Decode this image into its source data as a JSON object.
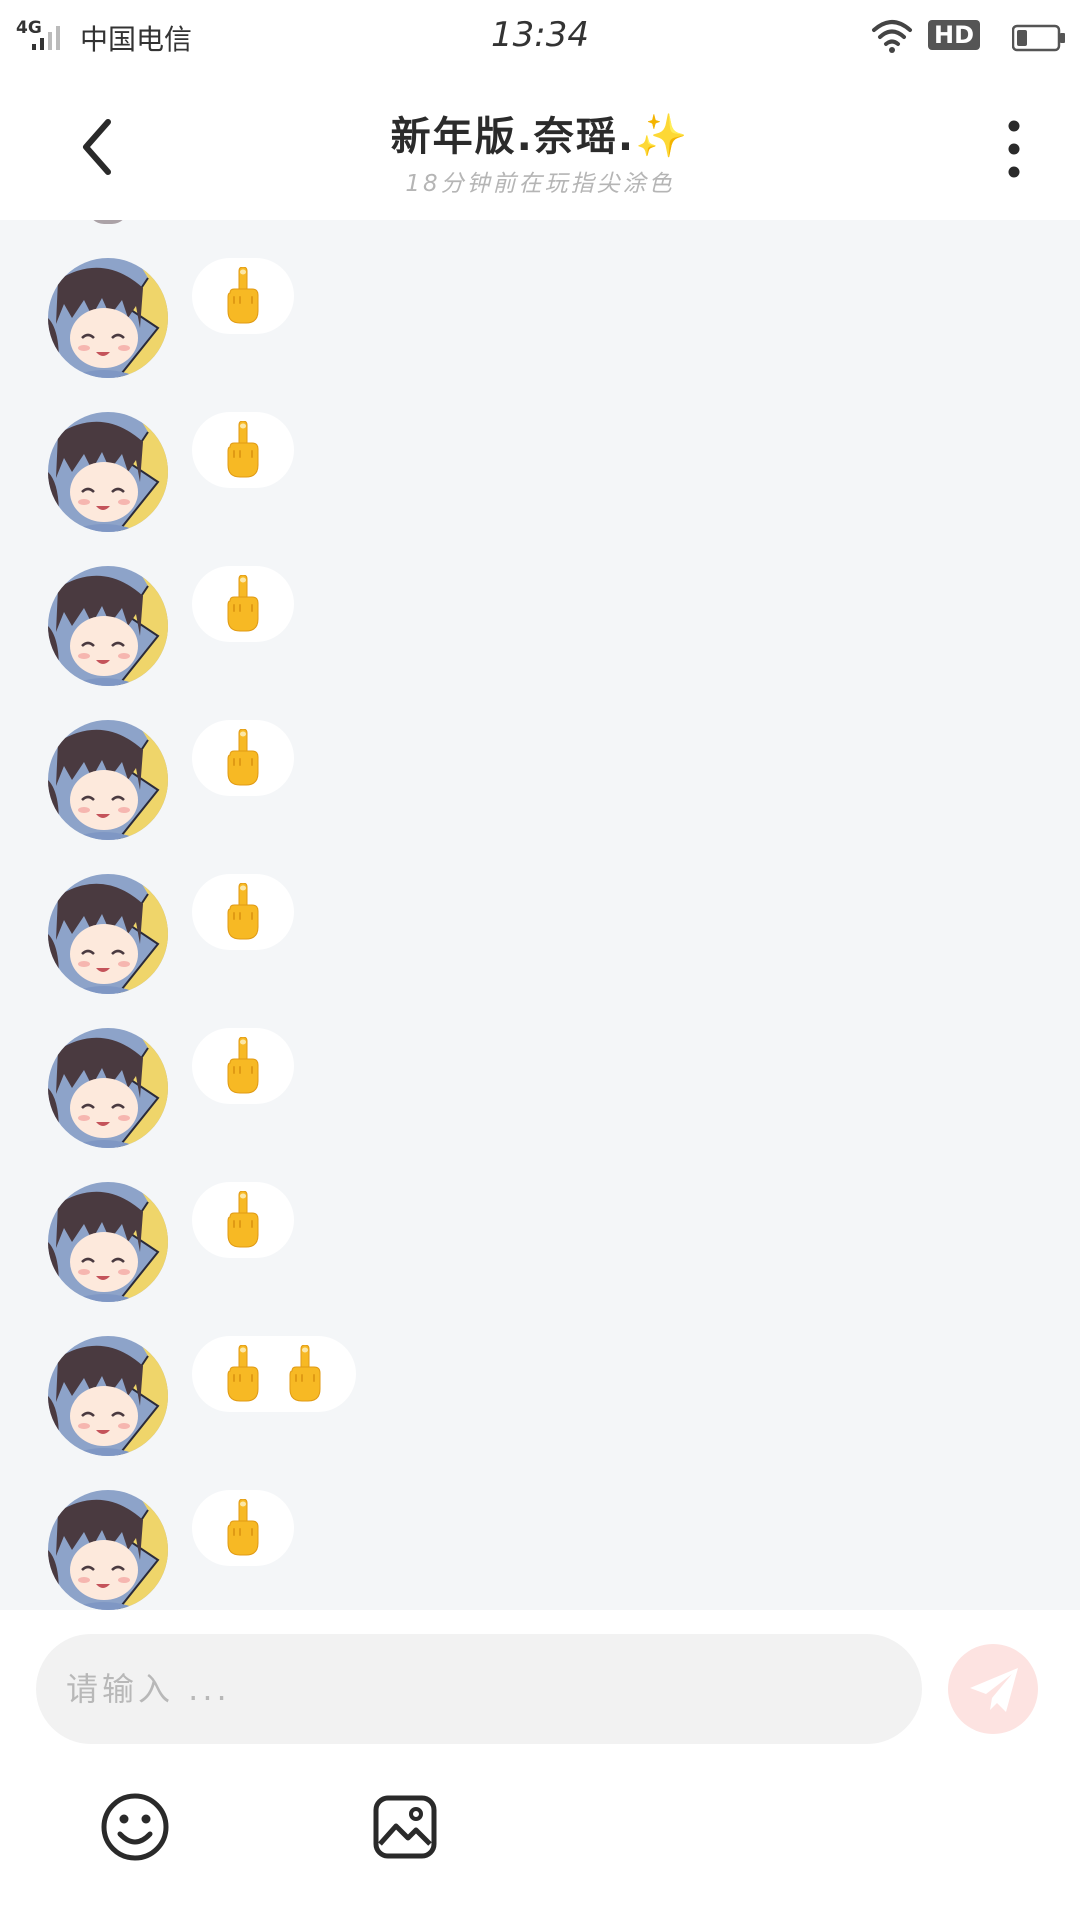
{
  "status_bar": {
    "network": "4G",
    "carrier": "中国电信",
    "time": "13:34",
    "hd_label": "HD"
  },
  "header": {
    "title": "新年版.奈瑶.",
    "title_emoji": "✨",
    "subtitle": "18分钟前在玩指尖涂色"
  },
  "messages": [
    {
      "emoji": [
        "middle-finger-emoji"
      ]
    },
    {
      "emoji": [
        "middle-finger-emoji"
      ]
    },
    {
      "emoji": [
        "middle-finger-emoji"
      ]
    },
    {
      "emoji": [
        "middle-finger-emoji"
      ]
    },
    {
      "emoji": [
        "middle-finger-emoji"
      ]
    },
    {
      "emoji": [
        "middle-finger-emoji"
      ]
    },
    {
      "emoji": [
        "middle-finger-emoji"
      ]
    },
    {
      "emoji": [
        "middle-finger-emoji",
        "middle-finger-emoji"
      ]
    },
    {
      "emoji": [
        "middle-finger-emoji"
      ]
    }
  ],
  "composer": {
    "placeholder": "请输入 ...",
    "send_icon": "send-icon",
    "tools": [
      "emoji-icon",
      "image-icon"
    ]
  },
  "colors": {
    "chat_background": "#f4f6f8",
    "bubble": "#ffffff",
    "send_button": "#fde3e1",
    "send_icon": "#ffffff",
    "emoji_yellow": "#f7b924"
  }
}
